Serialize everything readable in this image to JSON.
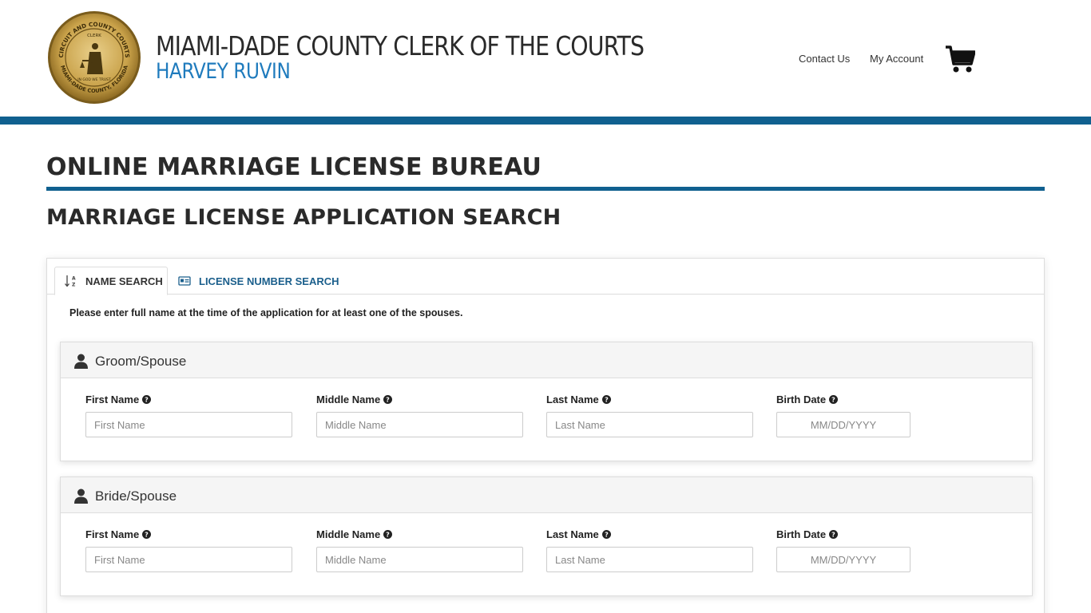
{
  "header": {
    "title": "MIAMI-DADE COUNTY CLERK OF THE COURTS",
    "subtitle": "HARVEY RUVIN",
    "nav": {
      "contact": "Contact Us",
      "account": "My Account"
    },
    "seal": {
      "top_text": "CIRCUIT AND COUNTY COURTS",
      "center_text": "CLERK",
      "motto": "IN GOD WE TRUST",
      "bottom_text": "MIAMI-DADE COUNTY, FLORIDA"
    }
  },
  "page": {
    "heading": "ONLINE MARRIAGE LICENSE BUREAU",
    "subheading": "MARRIAGE LICENSE APPLICATION SEARCH"
  },
  "tabs": [
    {
      "label": "NAME SEARCH",
      "icon": "sort-alpha-icon",
      "active": true
    },
    {
      "label": "LICENSE NUMBER SEARCH",
      "icon": "id-card-icon",
      "active": false
    }
  ],
  "instructions": "Please enter full name at the time of the application for at least one of the spouses.",
  "sections": [
    {
      "title": "Groom/Spouse",
      "fields": [
        {
          "label": "First Name",
          "placeholder": "First Name",
          "value": ""
        },
        {
          "label": "Middle Name",
          "placeholder": "Middle Name",
          "value": ""
        },
        {
          "label": "Last Name",
          "placeholder": "Last Name",
          "value": ""
        },
        {
          "label": "Birth Date",
          "placeholder": "MM/DD/YYYY",
          "value": ""
        }
      ]
    },
    {
      "title": "Bride/Spouse",
      "fields": [
        {
          "label": "First Name",
          "placeholder": "First Name",
          "value": ""
        },
        {
          "label": "Middle Name",
          "placeholder": "Middle Name",
          "value": ""
        },
        {
          "label": "Last Name",
          "placeholder": "Last Name",
          "value": ""
        },
        {
          "label": "Birth Date",
          "placeholder": "MM/DD/YYYY",
          "value": ""
        }
      ]
    }
  ],
  "colors": {
    "brand_blue": "#10608f",
    "subtitle_blue": "#1f7bbd",
    "tab_link": "#1b5f8c",
    "seal_gold": "#c9a24a"
  }
}
